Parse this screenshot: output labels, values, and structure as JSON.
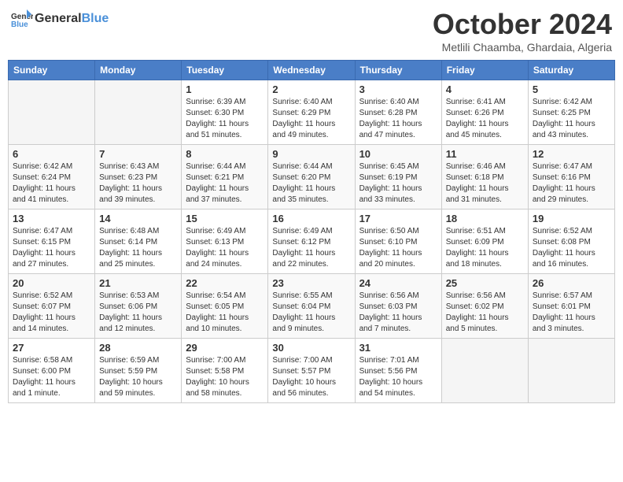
{
  "header": {
    "logo_line1": "General",
    "logo_line2": "Blue",
    "month_title": "October 2024",
    "location": "Metlili Chaamba, Ghardaia, Algeria"
  },
  "days_of_week": [
    "Sunday",
    "Monday",
    "Tuesday",
    "Wednesday",
    "Thursday",
    "Friday",
    "Saturday"
  ],
  "weeks": [
    [
      {
        "day": "",
        "empty": true
      },
      {
        "day": "",
        "empty": true
      },
      {
        "day": "1",
        "sunrise": "Sunrise: 6:39 AM",
        "sunset": "Sunset: 6:30 PM",
        "daylight": "Daylight: 11 hours and 51 minutes."
      },
      {
        "day": "2",
        "sunrise": "Sunrise: 6:40 AM",
        "sunset": "Sunset: 6:29 PM",
        "daylight": "Daylight: 11 hours and 49 minutes."
      },
      {
        "day": "3",
        "sunrise": "Sunrise: 6:40 AM",
        "sunset": "Sunset: 6:28 PM",
        "daylight": "Daylight: 11 hours and 47 minutes."
      },
      {
        "day": "4",
        "sunrise": "Sunrise: 6:41 AM",
        "sunset": "Sunset: 6:26 PM",
        "daylight": "Daylight: 11 hours and 45 minutes."
      },
      {
        "day": "5",
        "sunrise": "Sunrise: 6:42 AM",
        "sunset": "Sunset: 6:25 PM",
        "daylight": "Daylight: 11 hours and 43 minutes."
      }
    ],
    [
      {
        "day": "6",
        "sunrise": "Sunrise: 6:42 AM",
        "sunset": "Sunset: 6:24 PM",
        "daylight": "Daylight: 11 hours and 41 minutes."
      },
      {
        "day": "7",
        "sunrise": "Sunrise: 6:43 AM",
        "sunset": "Sunset: 6:23 PM",
        "daylight": "Daylight: 11 hours and 39 minutes."
      },
      {
        "day": "8",
        "sunrise": "Sunrise: 6:44 AM",
        "sunset": "Sunset: 6:21 PM",
        "daylight": "Daylight: 11 hours and 37 minutes."
      },
      {
        "day": "9",
        "sunrise": "Sunrise: 6:44 AM",
        "sunset": "Sunset: 6:20 PM",
        "daylight": "Daylight: 11 hours and 35 minutes."
      },
      {
        "day": "10",
        "sunrise": "Sunrise: 6:45 AM",
        "sunset": "Sunset: 6:19 PM",
        "daylight": "Daylight: 11 hours and 33 minutes."
      },
      {
        "day": "11",
        "sunrise": "Sunrise: 6:46 AM",
        "sunset": "Sunset: 6:18 PM",
        "daylight": "Daylight: 11 hours and 31 minutes."
      },
      {
        "day": "12",
        "sunrise": "Sunrise: 6:47 AM",
        "sunset": "Sunset: 6:16 PM",
        "daylight": "Daylight: 11 hours and 29 minutes."
      }
    ],
    [
      {
        "day": "13",
        "sunrise": "Sunrise: 6:47 AM",
        "sunset": "Sunset: 6:15 PM",
        "daylight": "Daylight: 11 hours and 27 minutes."
      },
      {
        "day": "14",
        "sunrise": "Sunrise: 6:48 AM",
        "sunset": "Sunset: 6:14 PM",
        "daylight": "Daylight: 11 hours and 25 minutes."
      },
      {
        "day": "15",
        "sunrise": "Sunrise: 6:49 AM",
        "sunset": "Sunset: 6:13 PM",
        "daylight": "Daylight: 11 hours and 24 minutes."
      },
      {
        "day": "16",
        "sunrise": "Sunrise: 6:49 AM",
        "sunset": "Sunset: 6:12 PM",
        "daylight": "Daylight: 11 hours and 22 minutes."
      },
      {
        "day": "17",
        "sunrise": "Sunrise: 6:50 AM",
        "sunset": "Sunset: 6:10 PM",
        "daylight": "Daylight: 11 hours and 20 minutes."
      },
      {
        "day": "18",
        "sunrise": "Sunrise: 6:51 AM",
        "sunset": "Sunset: 6:09 PM",
        "daylight": "Daylight: 11 hours and 18 minutes."
      },
      {
        "day": "19",
        "sunrise": "Sunrise: 6:52 AM",
        "sunset": "Sunset: 6:08 PM",
        "daylight": "Daylight: 11 hours and 16 minutes."
      }
    ],
    [
      {
        "day": "20",
        "sunrise": "Sunrise: 6:52 AM",
        "sunset": "Sunset: 6:07 PM",
        "daylight": "Daylight: 11 hours and 14 minutes."
      },
      {
        "day": "21",
        "sunrise": "Sunrise: 6:53 AM",
        "sunset": "Sunset: 6:06 PM",
        "daylight": "Daylight: 11 hours and 12 minutes."
      },
      {
        "day": "22",
        "sunrise": "Sunrise: 6:54 AM",
        "sunset": "Sunset: 6:05 PM",
        "daylight": "Daylight: 11 hours and 10 minutes."
      },
      {
        "day": "23",
        "sunrise": "Sunrise: 6:55 AM",
        "sunset": "Sunset: 6:04 PM",
        "daylight": "Daylight: 11 hours and 9 minutes."
      },
      {
        "day": "24",
        "sunrise": "Sunrise: 6:56 AM",
        "sunset": "Sunset: 6:03 PM",
        "daylight": "Daylight: 11 hours and 7 minutes."
      },
      {
        "day": "25",
        "sunrise": "Sunrise: 6:56 AM",
        "sunset": "Sunset: 6:02 PM",
        "daylight": "Daylight: 11 hours and 5 minutes."
      },
      {
        "day": "26",
        "sunrise": "Sunrise: 6:57 AM",
        "sunset": "Sunset: 6:01 PM",
        "daylight": "Daylight: 11 hours and 3 minutes."
      }
    ],
    [
      {
        "day": "27",
        "sunrise": "Sunrise: 6:58 AM",
        "sunset": "Sunset: 6:00 PM",
        "daylight": "Daylight: 11 hours and 1 minute."
      },
      {
        "day": "28",
        "sunrise": "Sunrise: 6:59 AM",
        "sunset": "Sunset: 5:59 PM",
        "daylight": "Daylight: 10 hours and 59 minutes."
      },
      {
        "day": "29",
        "sunrise": "Sunrise: 7:00 AM",
        "sunset": "Sunset: 5:58 PM",
        "daylight": "Daylight: 10 hours and 58 minutes."
      },
      {
        "day": "30",
        "sunrise": "Sunrise: 7:00 AM",
        "sunset": "Sunset: 5:57 PM",
        "daylight": "Daylight: 10 hours and 56 minutes."
      },
      {
        "day": "31",
        "sunrise": "Sunrise: 7:01 AM",
        "sunset": "Sunset: 5:56 PM",
        "daylight": "Daylight: 10 hours and 54 minutes."
      },
      {
        "day": "",
        "empty": true
      },
      {
        "day": "",
        "empty": true
      }
    ]
  ]
}
